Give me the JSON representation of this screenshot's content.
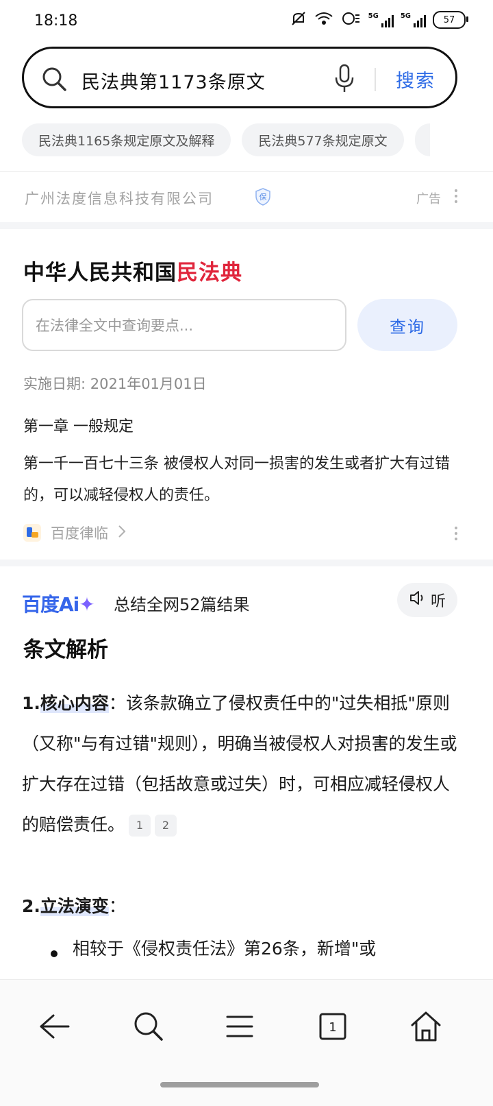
{
  "status_bar": {
    "time": "18:18",
    "network1": "5G",
    "network2": "5G",
    "battery": "57"
  },
  "search": {
    "query": "民法典第1173条原文",
    "submit_label": "搜索"
  },
  "suggestions": [
    "民法典1165条规定原文及解释",
    "民法典577条规定原文"
  ],
  "ad": {
    "company": "广州法度信息科技有限公司",
    "badge": "保",
    "label": "广告"
  },
  "law_card": {
    "title_prefix": "中华人民共和国",
    "title_highlight": "民法典",
    "search_placeholder": "在法律全文中查询要点...",
    "query_button": "查询",
    "effective_date": "实施日期: 2021年01月01日",
    "chapter": "第一章 一般规定",
    "article": "第一千一百七十三条 被侵权人对同一损害的发生或者扩大有过错的，可以减轻侵权人的责任。",
    "source": "百度律临"
  },
  "ai": {
    "brand": "百度Ai",
    "summary": "总结全网52篇结果",
    "listen": "听",
    "section_title": "条文解析",
    "item1_num": "1.",
    "item1_key": "核心内容",
    "item1_text": "：该条款确立了侵权责任中的\"过失相抵\"原则（又称\"与有过错\"规则），明确当被侵权人对损害的发生或扩大存在过错（包括故意或过失）时，可相应减轻侵权人的赔偿责任。",
    "item1_cite1": "1",
    "item1_cite2": "2",
    "item2_num": "2.",
    "item2_key": "立法演变",
    "item2_text": "：",
    "bullet1": "相较于《侵权责任法》第26条，新增\"或"
  },
  "nav": {
    "tab_count": "1"
  }
}
